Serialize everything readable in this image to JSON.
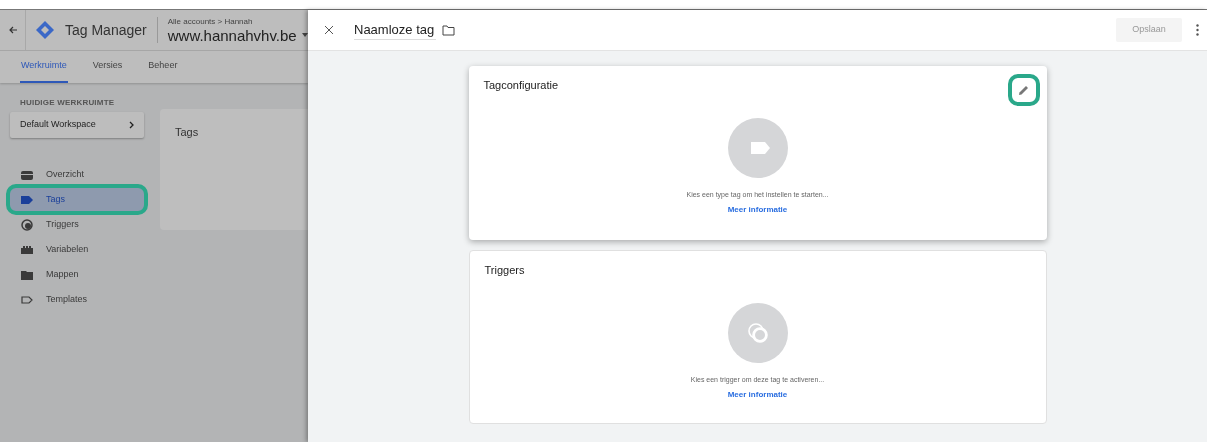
{
  "header": {
    "product": "Tag Manager",
    "breadcrumb": "Alle accounts > Hannah",
    "container": "www.hannahvhv.be"
  },
  "tabs": [
    {
      "label": "Werkruimte",
      "selected": true
    },
    {
      "label": "Versies",
      "selected": false
    },
    {
      "label": "Beheer",
      "selected": false
    }
  ],
  "workspace": {
    "heading": "HUIDIGE WERKRUIMTE",
    "name": "Default Workspace"
  },
  "nav": [
    {
      "label": "Overzicht",
      "kind": "overview",
      "selected": false,
      "highlighted": false
    },
    {
      "label": "Tags",
      "kind": "tag",
      "selected": true,
      "highlighted": true
    },
    {
      "label": "Triggers",
      "kind": "trigger",
      "selected": false,
      "highlighted": false
    },
    {
      "label": "Variabelen",
      "kind": "variable",
      "selected": false,
      "highlighted": false
    },
    {
      "label": "Mappen",
      "kind": "folder",
      "selected": false,
      "highlighted": false
    },
    {
      "label": "Templates",
      "kind": "template",
      "selected": false,
      "highlighted": false
    }
  ],
  "list_card": {
    "title": "Tags"
  },
  "editor": {
    "title": "Naamloze tag",
    "save": "Opslaan",
    "cards": [
      {
        "title": "Tagconfiguratie",
        "kind": "tag",
        "message": "Kies een type tag om het instellen te starten...",
        "link": "Meer informatie",
        "editable": true,
        "highlighted": true
      },
      {
        "title": "Triggers",
        "kind": "trigger",
        "message": "Kies een trigger om deze tag te activeren...",
        "link": "Meer informatie",
        "editable": false,
        "highlighted": false
      }
    ]
  }
}
